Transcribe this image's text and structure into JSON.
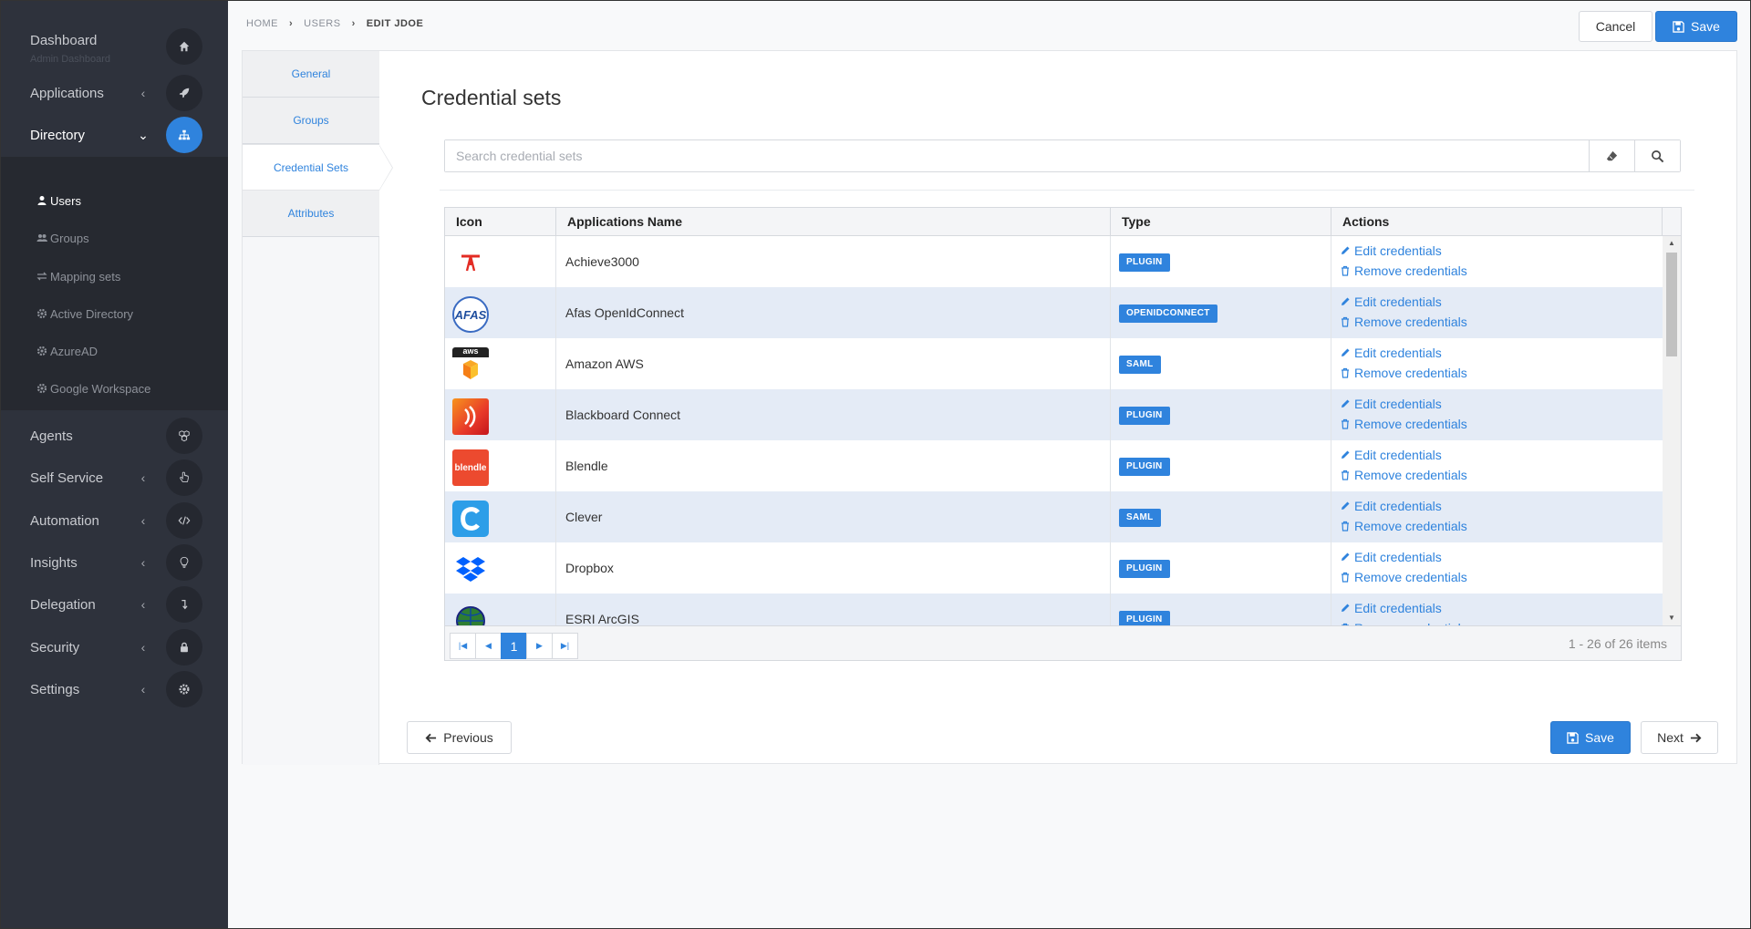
{
  "sidebar": {
    "dashboard": {
      "label": "Dashboard",
      "sub": "Admin Dashboard"
    },
    "items": [
      {
        "label": "Applications"
      },
      {
        "label": "Directory"
      },
      {
        "label": "Agents"
      },
      {
        "label": "Self Service"
      },
      {
        "label": "Automation"
      },
      {
        "label": "Insights"
      },
      {
        "label": "Delegation"
      },
      {
        "label": "Security"
      },
      {
        "label": "Settings"
      }
    ],
    "directory_sub": [
      {
        "label": "Users"
      },
      {
        "label": "Groups"
      },
      {
        "label": "Mapping sets"
      },
      {
        "label": "Active Directory"
      },
      {
        "label": "AzureAD"
      },
      {
        "label": "Google Workspace"
      }
    ]
  },
  "breadcrumb": [
    "HOME",
    "USERS",
    "EDIT JDOE"
  ],
  "toolbar": {
    "cancel_label": "Cancel",
    "save_label": "Save"
  },
  "tabs": [
    "General",
    "Groups",
    "Credential Sets",
    "Attributes"
  ],
  "page_title": "Credential sets",
  "search": {
    "placeholder": "Search credential sets",
    "value": ""
  },
  "grid": {
    "columns": [
      "Icon",
      "Applications Name",
      "Type",
      "Actions"
    ],
    "edit_label": "Edit credentials",
    "remove_label": "Remove credentials",
    "rows": [
      {
        "name": "Achieve3000",
        "type": "PLUGIN",
        "icon": "achieve3000-logo-icon"
      },
      {
        "name": "Afas OpenIdConnect",
        "type": "OPENIDCONNECT",
        "icon": "afas-logo-icon"
      },
      {
        "name": "Amazon AWS",
        "type": "SAML",
        "icon": "aws-logo-icon"
      },
      {
        "name": "Blackboard Connect",
        "type": "PLUGIN",
        "icon": "blackboard-logo-icon"
      },
      {
        "name": "Blendle",
        "type": "PLUGIN",
        "icon": "blendle-logo-icon"
      },
      {
        "name": "Clever",
        "type": "SAML",
        "icon": "clever-logo-icon"
      },
      {
        "name": "Dropbox",
        "type": "PLUGIN",
        "icon": "dropbox-logo-icon"
      },
      {
        "name": "ESRI ArcGIS",
        "type": "PLUGIN",
        "icon": "esri-logo-icon"
      }
    ],
    "pager": {
      "current_page": "1",
      "info": "1 - 26 of 26 items"
    }
  },
  "footer": {
    "previous_label": "Previous",
    "save_label": "Save",
    "next_label": "Next"
  },
  "logo_text": {
    "afas": "AFAS",
    "aws": "aws",
    "blendle": "blendle"
  },
  "colors": {
    "accent": "#2f83dd",
    "sidebar": "#2e323c",
    "row_alt": "#e4ebf6"
  }
}
